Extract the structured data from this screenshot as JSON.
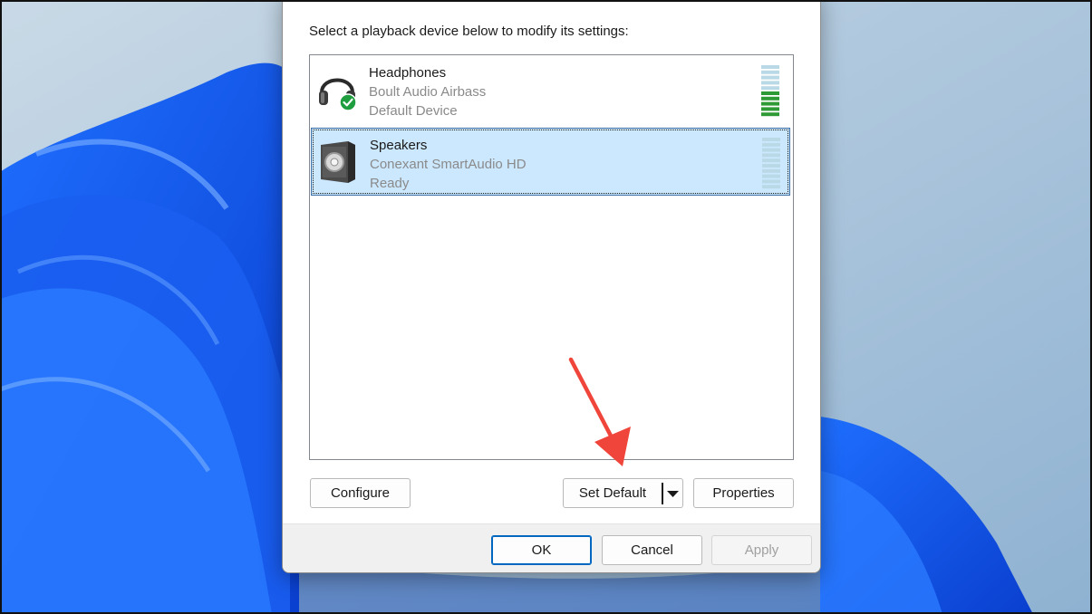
{
  "instruction": "Select a playback device below to modify its settings:",
  "devices": [
    {
      "name": "Headphones",
      "description": "Boult Audio Airbass",
      "status": "Default Device",
      "icon": "headphones-icon",
      "badge": "default-check-icon",
      "level_fraction": 0.5,
      "selected": false
    },
    {
      "name": "Speakers",
      "description": "Conexant SmartAudio HD",
      "status": "Ready",
      "icon": "speaker-icon",
      "level_fraction": 0,
      "selected": true
    }
  ],
  "buttons": {
    "configure": "Configure",
    "set_default": "Set Default",
    "properties": "Properties",
    "ok": "OK",
    "cancel": "Cancel",
    "apply": "Apply"
  },
  "colors": {
    "selection_bg": "#cce8ff",
    "meter_active": "#2e9a35",
    "meter_idle": "#b9d9e6",
    "check_badge": "#1e9e3e",
    "annotation_arrow": "#f0453a",
    "ok_border": "#0067c0"
  },
  "annotation": {
    "type": "arrow",
    "points_to": "set-default-button"
  }
}
